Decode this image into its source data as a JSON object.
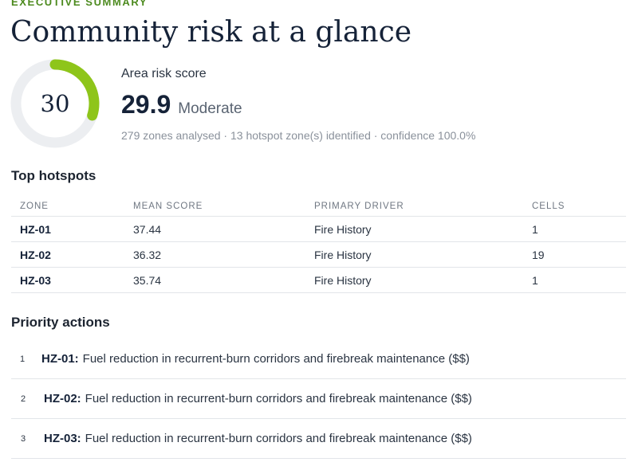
{
  "header": {
    "eyebrow": "EXECUTIVE SUMMARY",
    "title": "Community risk at a glance"
  },
  "gauge": {
    "value": "30",
    "fraction": 0.299,
    "track_color": "#eceef1",
    "fill_color": "#8ec51a"
  },
  "score": {
    "label": "Area risk score",
    "value": "29.9",
    "band": "Moderate",
    "meta": "279 zones analysed · 13 hotspot zone(s) identified · confidence 100.0%"
  },
  "hotspots": {
    "title": "Top hotspots",
    "columns": [
      "ZONE",
      "MEAN SCORE",
      "PRIMARY DRIVER",
      "CELLS"
    ],
    "rows": [
      [
        "HZ-01",
        "37.44",
        "Fire History",
        "1"
      ],
      [
        "HZ-02",
        "36.32",
        "Fire History",
        "19"
      ],
      [
        "HZ-03",
        "35.74",
        "Fire History",
        "1"
      ]
    ]
  },
  "actions": {
    "title": "Priority actions",
    "items": [
      {
        "num": "1",
        "zone": "HZ-01:",
        "text": "Fuel reduction in recurrent-burn corridors and firebreak maintenance ($$)"
      },
      {
        "num": "2",
        "zone": "HZ-02:",
        "text": "Fuel reduction in recurrent-burn corridors and firebreak maintenance ($$)"
      },
      {
        "num": "3",
        "zone": "HZ-03:",
        "text": "Fuel reduction in recurrent-burn corridors and firebreak maintenance ($$)"
      }
    ]
  }
}
